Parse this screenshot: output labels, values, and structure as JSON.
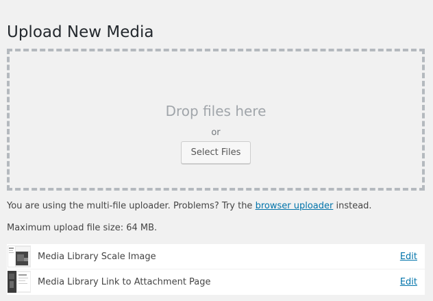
{
  "page": {
    "title": "Upload New Media"
  },
  "dropzone": {
    "drop_text": "Drop files here",
    "or_text": "or",
    "select_button": "Select Files"
  },
  "notice": {
    "prefix": "You are using the multi-file uploader. Problems? Try the ",
    "link": "browser uploader",
    "suffix": " instead."
  },
  "max_upload": "Maximum upload file size: 64 MB.",
  "items": [
    {
      "title": "Media Library Scale Image",
      "edit": "Edit",
      "thumbnail_icon": "image-thumbnail-icon"
    },
    {
      "title": "Media Library Link to Attachment Page",
      "edit": "Edit",
      "thumbnail_icon": "image-thumbnail-icon"
    }
  ],
  "colors": {
    "background": "#f1f1f1",
    "link": "#0073aa",
    "dashed_border": "#b4b9be"
  }
}
